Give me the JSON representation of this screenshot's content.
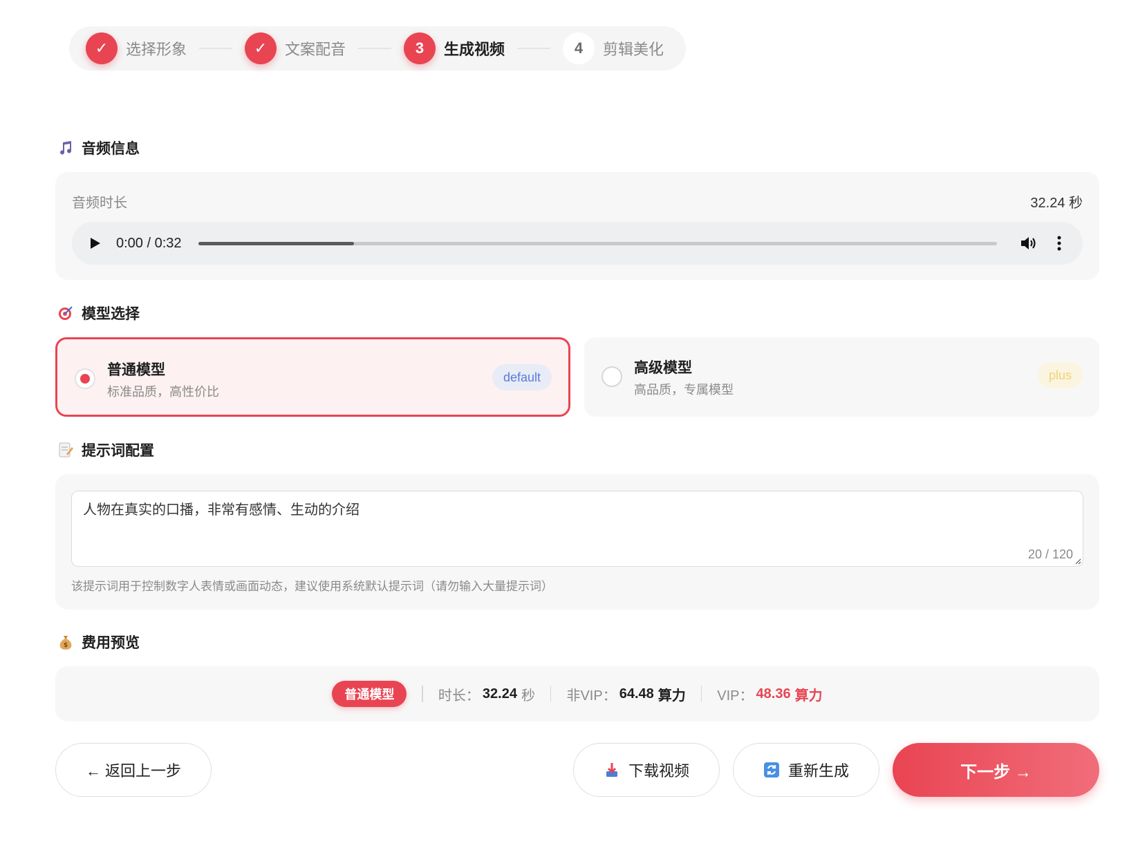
{
  "stepper": {
    "steps": [
      {
        "index": "✓",
        "label": "选择形象",
        "state": "done"
      },
      {
        "index": "✓",
        "label": "文案配音",
        "state": "done"
      },
      {
        "index": "3",
        "label": "生成视频",
        "state": "active"
      },
      {
        "index": "4",
        "label": "剪辑美化",
        "state": "todo"
      }
    ]
  },
  "audio": {
    "title": "音频信息",
    "duration_label": "音频时长",
    "duration_value": "32.24 秒",
    "player": {
      "time": "0:00 / 0:32",
      "buffered_fraction": 0.195
    }
  },
  "model": {
    "title": "模型选择",
    "options": [
      {
        "name": "普通模型",
        "desc": "标准品质，高性价比",
        "badge": "default",
        "selected": true
      },
      {
        "name": "高级模型",
        "desc": "高品质，专属模型",
        "badge": "plus",
        "selected": false
      }
    ]
  },
  "prompt": {
    "title": "提示词配置",
    "value": "人物在真实的口播，非常有感情、生动的介绍",
    "count": "20 / 120",
    "hint": "该提示词用于控制数字人表情或画面动态，建议使用系统默认提示词（请勿输入大量提示词）"
  },
  "cost": {
    "title": "费用预览",
    "model_tag": "普通模型",
    "duration_label": "时长：",
    "duration_value": "32.24",
    "duration_unit": "秒",
    "nonvip_label": "非VIP：",
    "nonvip_value": "64.48",
    "nonvip_unit": "算力",
    "vip_label": "VIP：",
    "vip_value": "48.36",
    "vip_unit": "算力"
  },
  "actions": {
    "back": "← 返回上一步",
    "download": "下载视频",
    "regenerate": "重新生成",
    "next": "下一步 →"
  },
  "colors": {
    "accent": "#e94452",
    "default_badge": "#5b7ad6",
    "plus_badge": "#f1d37a"
  }
}
